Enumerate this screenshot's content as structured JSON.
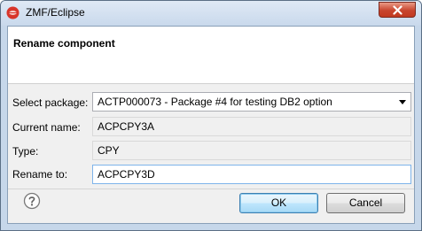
{
  "window": {
    "title": "ZMF/Eclipse",
    "app_icon": "eclipse-icon",
    "close_icon": "close-icon"
  },
  "dialog": {
    "heading": "Rename component"
  },
  "form": {
    "package_label": "Select package:",
    "package_value": "ACTP000073 - Package #4 for testing DB2 option",
    "current_name_label": "Current name:",
    "current_name_value": "ACPCPY3A",
    "type_label": "Type:",
    "type_value": "CPY",
    "rename_label": "Rename to:",
    "rename_value": "ACPCPY3D"
  },
  "buttons": {
    "help_icon": "help-icon",
    "ok_label": "OK",
    "cancel_label": "Cancel"
  },
  "colors": {
    "titlebar": "#c9d9ec",
    "close_button": "#c8452e",
    "dialog_body": "#f0f0f0",
    "header_background": "#ffffff"
  }
}
